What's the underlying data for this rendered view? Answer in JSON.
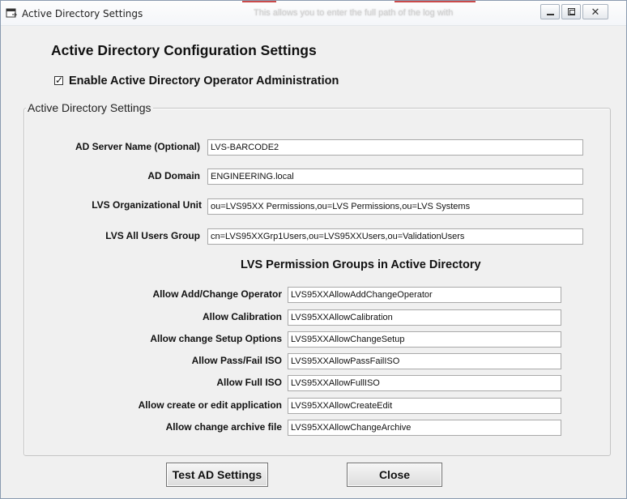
{
  "window": {
    "title": "Active Directory Settings",
    "background_hint_text": "This allows you to enter the full path of the log with"
  },
  "heading": "Active Directory Configuration Settings",
  "enable_checkbox": {
    "label": "Enable Active Directory Operator Administration",
    "checked": true,
    "mark": "☑"
  },
  "group": {
    "label": "Active Directory Settings",
    "settings": [
      {
        "label": "AD Server Name (Optional)",
        "value": "LVS-BARCODE2"
      },
      {
        "label": "AD Domain",
        "value": "ENGINEERING.local"
      },
      {
        "label": "LVS Organizational  Unit",
        "value": "ou=LVS95XX Permissions,ou=LVS Permissions,ou=LVS Systems"
      },
      {
        "label": "LVS All Users Group",
        "value": "cn=LVS95XXGrp1Users,ou=LVS95XXUsers,ou=ValidationUsers"
      }
    ],
    "permissions_heading": "LVS Permission Groups in Active Directory",
    "permissions": [
      {
        "label": "Allow Add/Change Operator",
        "value": "LVS95XXAllowAddChangeOperator"
      },
      {
        "label": "Allow Calibration",
        "value": "LVS95XXAllowCalibration"
      },
      {
        "label": "Allow change Setup Options",
        "value": "LVS95XXAllowChangeSetup"
      },
      {
        "label": "Allow Pass/Fail ISO",
        "value": "LVS95XXAllowPassFailISO"
      },
      {
        "label": "Allow Full ISO",
        "value": "LVS95XXAllowFullISO"
      },
      {
        "label": "Allow create or edit application",
        "value": "LVS95XXAllowCreateEdit"
      },
      {
        "label": "Allow change archive file",
        "value": "LVS95XXAllowChangeArchive"
      }
    ]
  },
  "buttons": {
    "test": "Test AD Settings",
    "close": "Close"
  },
  "colors": {
    "window_bg": "#f0f0f0",
    "field_border": "#a9a9a9",
    "titlebar_accent": "#c94a4a"
  }
}
